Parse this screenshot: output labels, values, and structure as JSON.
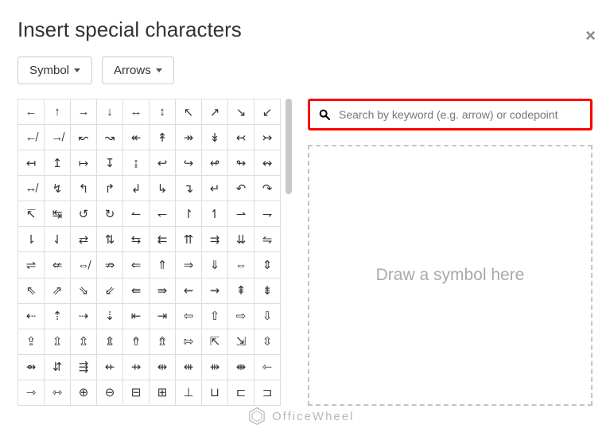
{
  "title": "Insert special characters",
  "dropdowns": {
    "category": "Symbol",
    "subcategory": "Arrows"
  },
  "search": {
    "placeholder": "Search by keyword (e.g. arrow) or codepoint"
  },
  "draw_prompt": "Draw a symbol here",
  "watermark": "OfficeWheel",
  "grid": [
    [
      "←",
      "↑",
      "→",
      "↓",
      "↔",
      "↕",
      "↖",
      "↗",
      "↘",
      "↙"
    ],
    [
      "↚",
      "↛",
      "↜",
      "↝",
      "↞",
      "↟",
      "↠",
      "↡",
      "↢",
      "↣"
    ],
    [
      "↤",
      "↥",
      "↦",
      "↧",
      "↨",
      "↩",
      "↪",
      "↫",
      "↬",
      "↭"
    ],
    [
      "↮",
      "↯",
      "↰",
      "↱",
      "↲",
      "↳",
      "↴",
      "↵",
      "↶",
      "↷"
    ],
    [
      "↸",
      "↹",
      "↺",
      "↻",
      "↼",
      "↽",
      "↾",
      "↿",
      "⇀",
      "⇁"
    ],
    [
      "⇂",
      "⇃",
      "⇄",
      "⇅",
      "⇆",
      "⇇",
      "⇈",
      "⇉",
      "⇊",
      "⇋"
    ],
    [
      "⇌",
      "⇍",
      "⇎",
      "⇏",
      "⇐",
      "⇑",
      "⇒",
      "⇓",
      "⇔",
      "⇕"
    ],
    [
      "⇖",
      "⇗",
      "⇘",
      "⇙",
      "⇚",
      "⇛",
      "⇜",
      "⇝",
      "⇞",
      "⇟"
    ],
    [
      "⇠",
      "⇡",
      "⇢",
      "⇣",
      "⇤",
      "⇥",
      "⇦",
      "⇧",
      "⇨",
      "⇩"
    ],
    [
      "⇪",
      "⇫",
      "⇬",
      "⇭",
      "⇮",
      "⇯",
      "⇰",
      "⇱",
      "⇲",
      "⇳"
    ],
    [
      "⇴",
      "⇵",
      "⇶",
      "⇷",
      "⇸",
      "⇹",
      "⇺",
      "⇻",
      "⇼",
      "⇽"
    ],
    [
      "⇾",
      "⇿",
      "⊕",
      "⊖",
      "⊟",
      "⊞",
      "⊥",
      "⊔",
      "⊏",
      "⊐"
    ]
  ]
}
